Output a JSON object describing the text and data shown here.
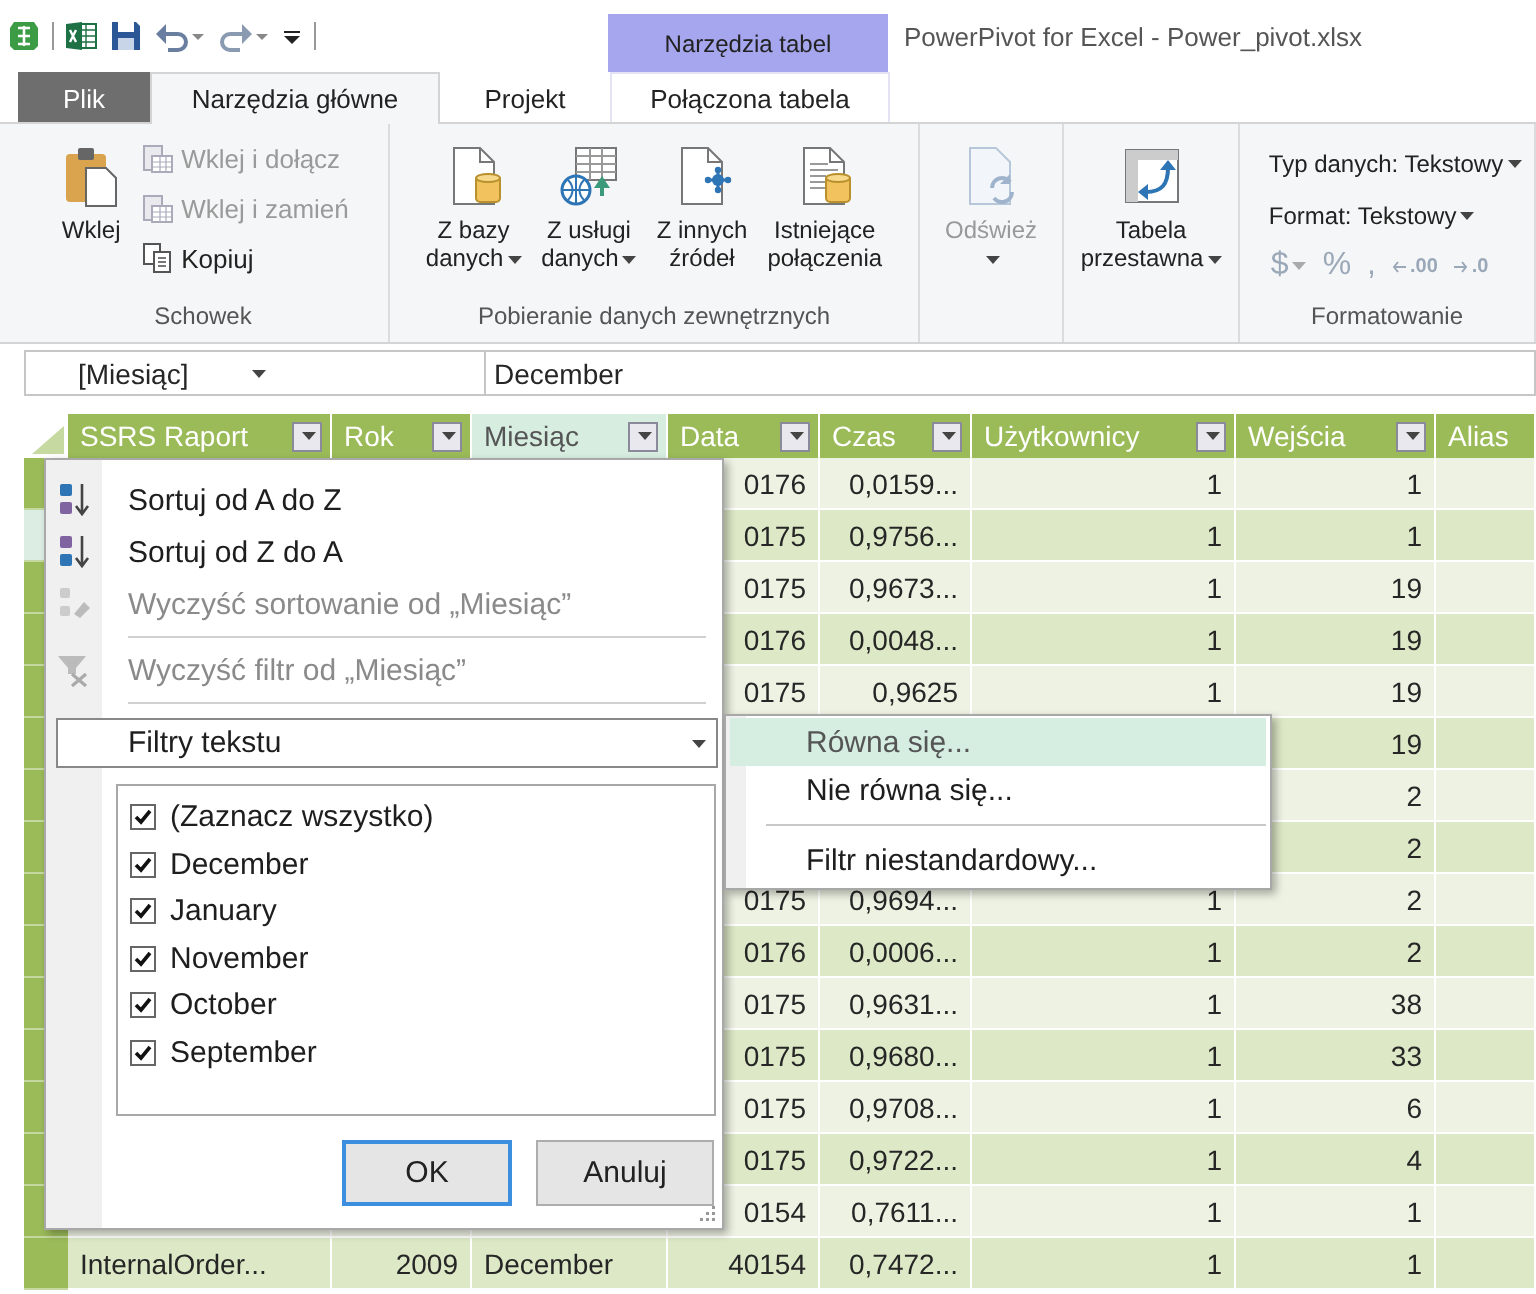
{
  "window": {
    "title": "PowerPivot for Excel - Power_pivot.xlsx"
  },
  "contextual_group": {
    "label": "Narzędzia tabel"
  },
  "tabs": [
    {
      "label": "Plik",
      "kind": "file",
      "selected": false
    },
    {
      "label": "Narzędzia główne",
      "kind": "tab",
      "selected": true
    },
    {
      "label": "Projekt",
      "kind": "tab",
      "selected": false
    },
    {
      "label": "Połączona tabela",
      "kind": "contextual",
      "selected": false
    }
  ],
  "ribbon": {
    "groups": [
      {
        "kind": "clipboard",
        "label": "Schowek",
        "large": [
          {
            "lines": [
              "Wklej"
            ],
            "dropdown": false,
            "disabled": false
          }
        ],
        "small": [
          {
            "label": "Wklej i dołącz",
            "disabled": true
          },
          {
            "label": "Wklej i zamień",
            "disabled": true
          },
          {
            "label": "Kopiuj",
            "disabled": false
          }
        ]
      },
      {
        "kind": "large",
        "label": "Pobieranie danych zewnętrznych",
        "large": [
          {
            "lines": [
              "Z bazy",
              "danych"
            ],
            "dropdown": true,
            "disabled": false
          },
          {
            "lines": [
              "Z usługi",
              "danych"
            ],
            "dropdown": true,
            "disabled": false
          },
          {
            "lines": [
              "Z innych",
              "źródeł"
            ],
            "dropdown": false,
            "disabled": false
          },
          {
            "lines": [
              "Istniejące",
              "połączenia"
            ],
            "dropdown": false,
            "disabled": false
          }
        ]
      },
      {
        "kind": "large",
        "large": [
          {
            "lines": [
              "Odśwież"
            ],
            "dropdown": true,
            "disabled": true
          }
        ]
      },
      {
        "kind": "large",
        "large": [
          {
            "lines": [
              "Tabela",
              "przestawna"
            ],
            "dropdown": true,
            "disabled": false
          }
        ]
      },
      {
        "kind": "format",
        "label": "Formatowanie",
        "dropdowns": [
          {
            "label": "Typ danych: Tekstowy"
          },
          {
            "label": "Format: Tekstowy"
          }
        ],
        "symbols": [
          {
            "label": "$",
            "kind": "symbol",
            "dropdown": true,
            "disabled": true
          },
          {
            "label": "%",
            "kind": "symbol",
            "dropdown": false,
            "disabled": true
          },
          {
            "label": ",",
            "kind": "symbol",
            "dropdown": false,
            "disabled": true
          },
          {
            "label": ".00",
            "kind": "decimal",
            "dropdown": false,
            "disabled": true
          },
          {
            "label": ".0",
            "kind": "decimal",
            "dropdown": false,
            "disabled": true
          }
        ]
      }
    ]
  },
  "formula_bar": {
    "name_box": "[Miesiąc]",
    "value": "December"
  },
  "table": {
    "columns": [
      {
        "label": "SSRS Raport",
        "filter": true,
        "selected": false
      },
      {
        "label": "Rok",
        "filter": true,
        "selected": false
      },
      {
        "label": "Miesiąc",
        "filter": true,
        "selected": true
      },
      {
        "label": "Data",
        "filter": true,
        "selected": false
      },
      {
        "label": "Czas",
        "filter": true,
        "selected": false
      },
      {
        "label": "Użytkownicy",
        "filter": true,
        "selected": false
      },
      {
        "label": "Wejścia",
        "filter": true,
        "selected": false
      },
      {
        "label": "Alias",
        "filter": false,
        "selected": false
      }
    ],
    "rows": [
      {
        "selected": false,
        "cells": [
          null,
          null,
          null,
          "0176",
          "0,0159...",
          "1",
          "1",
          null
        ]
      },
      {
        "selected": true,
        "cells": [
          null,
          null,
          null,
          "0175",
          "0,9756...",
          "1",
          "1",
          null
        ]
      },
      {
        "selected": false,
        "cells": [
          null,
          null,
          null,
          "0175",
          "0,9673...",
          "1",
          "19",
          null
        ]
      },
      {
        "selected": false,
        "cells": [
          null,
          null,
          null,
          "0176",
          "0,0048...",
          "1",
          "19",
          null
        ]
      },
      {
        "selected": false,
        "cells": [
          null,
          null,
          null,
          "0175",
          "0,9625",
          "1",
          "19",
          null
        ]
      },
      {
        "selected": false,
        "cells": [
          null,
          null,
          null,
          null,
          null,
          null,
          "19",
          null
        ]
      },
      {
        "selected": false,
        "cells": [
          null,
          null,
          null,
          null,
          null,
          null,
          "2",
          null
        ]
      },
      {
        "selected": false,
        "cells": [
          null,
          null,
          null,
          null,
          null,
          null,
          "2",
          null
        ]
      },
      {
        "selected": false,
        "cells": [
          null,
          null,
          null,
          "0175",
          "0,9694...",
          "1",
          "2",
          null
        ]
      },
      {
        "selected": false,
        "cells": [
          null,
          null,
          null,
          "0176",
          "0,0006...",
          "1",
          "2",
          null
        ]
      },
      {
        "selected": false,
        "cells": [
          null,
          null,
          null,
          "0175",
          "0,9631...",
          "1",
          "38",
          null
        ]
      },
      {
        "selected": false,
        "cells": [
          null,
          null,
          null,
          "0175",
          "0,9680...",
          "1",
          "33",
          null
        ]
      },
      {
        "selected": false,
        "cells": [
          null,
          null,
          null,
          "0175",
          "0,9708...",
          "1",
          "6",
          null
        ]
      },
      {
        "selected": false,
        "cells": [
          null,
          null,
          null,
          "0175",
          "0,9722...",
          "1",
          "4",
          null
        ]
      },
      {
        "selected": false,
        "cells": [
          null,
          null,
          null,
          "0154",
          "0,7611...",
          "1",
          "1",
          null
        ]
      },
      {
        "selected": false,
        "cells": [
          "InternalOrder...",
          "2009",
          "December",
          "40154",
          "0,7472...",
          "1",
          "1",
          null
        ]
      }
    ]
  },
  "filter_menu": {
    "items": [
      {
        "label": "Sortuj od A do Z",
        "disabled": false
      },
      {
        "label": "Sortuj od Z do A",
        "disabled": false
      },
      {
        "label": "Wyczyść sortowanie od „Miesiąc”",
        "disabled": true
      },
      {
        "label": "Wyczyść filtr od „Miesiąc”",
        "disabled": true
      }
    ],
    "submenu": {
      "label": "Filtry tekstu",
      "expanded": true,
      "items": [
        {
          "label": "Równa się...",
          "selected": true
        },
        {
          "label": "Nie równa się...",
          "selected": false
        },
        {
          "label": "Filtr niestandardowy...",
          "selected": false
        }
      ]
    },
    "values": [
      {
        "label": "(Zaznacz wszystko)",
        "checked": true
      },
      {
        "label": "December",
        "checked": true
      },
      {
        "label": "January",
        "checked": true
      },
      {
        "label": "November",
        "checked": true
      },
      {
        "label": "October",
        "checked": true
      },
      {
        "label": "September",
        "checked": true
      }
    ],
    "buttons": [
      {
        "label": "OK",
        "focused": true
      },
      {
        "label": "Anuluj",
        "focused": false
      }
    ]
  }
}
